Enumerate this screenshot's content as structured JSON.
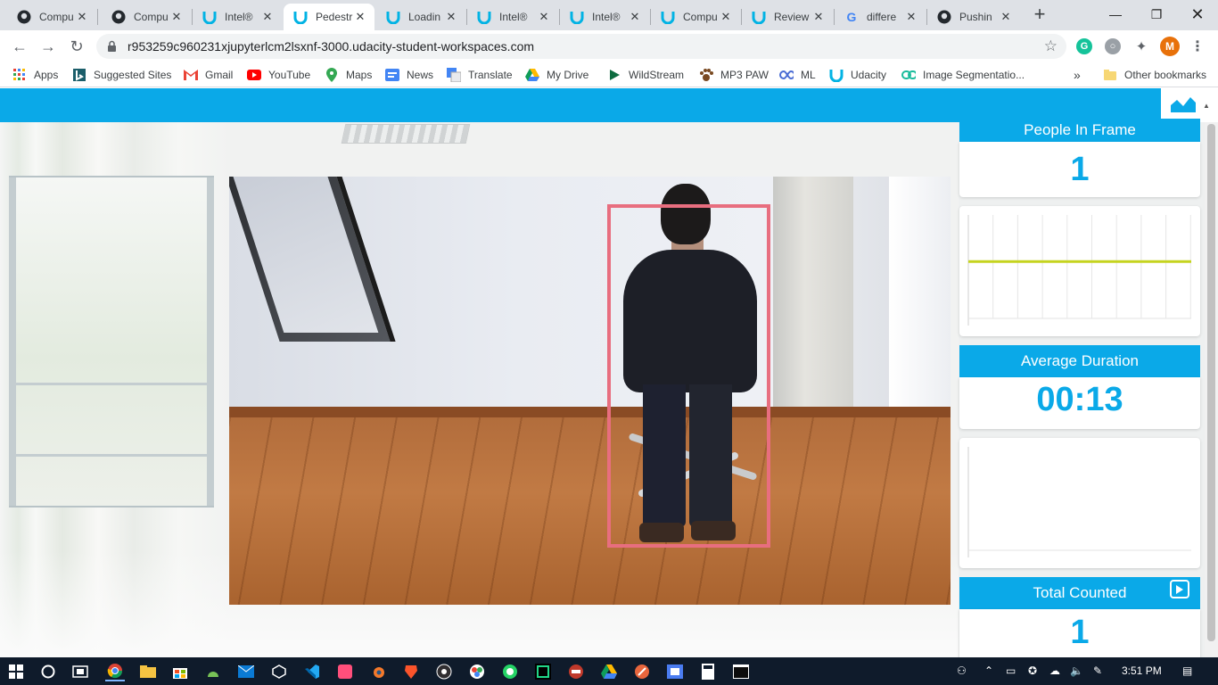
{
  "browser": {
    "tabs": [
      {
        "title": "Compu",
        "icon": "github-icon",
        "active": false
      },
      {
        "title": "Compu",
        "icon": "github-icon",
        "active": false
      },
      {
        "title": "Intel®",
        "icon": "udacity-icon",
        "active": false
      },
      {
        "title": "Pedestr",
        "icon": "udacity-icon",
        "active": true
      },
      {
        "title": "Loadin",
        "icon": "udacity-icon",
        "active": false
      },
      {
        "title": "Intel®",
        "icon": "udacity-icon",
        "active": false
      },
      {
        "title": "Intel®",
        "icon": "udacity-icon",
        "active": false
      },
      {
        "title": "Compu",
        "icon": "udacity-icon",
        "active": false
      },
      {
        "title": "Review",
        "icon": "udacity-icon",
        "active": false
      },
      {
        "title": "differe",
        "icon": "google-icon",
        "active": false
      },
      {
        "title": "Pushin",
        "icon": "github-icon",
        "active": false
      }
    ],
    "new_tab_label": "+",
    "url": "r953259c960231xjupyterlcm2lsxnf-3000.udacity-student-workspaces.com",
    "profile_initial": "M",
    "bookmarks": [
      {
        "label": "Apps",
        "icon": "apps-grid-icon"
      },
      {
        "label": "Suggested Sites",
        "icon": "bing-icon"
      },
      {
        "label": "Gmail",
        "icon": "gmail-icon"
      },
      {
        "label": "YouTube",
        "icon": "youtube-icon"
      },
      {
        "label": "Maps",
        "icon": "maps-pin-icon"
      },
      {
        "label": "News",
        "icon": "google-news-icon"
      },
      {
        "label": "Translate",
        "icon": "translate-icon"
      },
      {
        "label": "My Drive",
        "icon": "drive-icon"
      },
      {
        "label": "WildStream",
        "icon": "wildstream-icon"
      },
      {
        "label": "MP3 PAW",
        "icon": "paw-icon"
      },
      {
        "label": "ML",
        "icon": "infinity-icon"
      },
      {
        "label": "Udacity",
        "icon": "udacity-icon"
      },
      {
        "label": "Image Segmentatio...",
        "icon": "link-icon"
      }
    ],
    "more_bookmarks": "»",
    "other_bookmarks": "Other bookmarks"
  },
  "dashboard": {
    "people_in_frame": {
      "title": "People In Frame",
      "value": "1"
    },
    "average_duration": {
      "title": "Average Duration",
      "value": "00:13"
    },
    "total_counted": {
      "title": "Total Counted",
      "value": "1"
    },
    "colors": {
      "accent": "#0aa9e8",
      "line": "#c5d41f",
      "bbox": "#e86e7f"
    },
    "people_chart_level": 0.55
  },
  "taskbar": {
    "clock": "3:51 PM"
  }
}
